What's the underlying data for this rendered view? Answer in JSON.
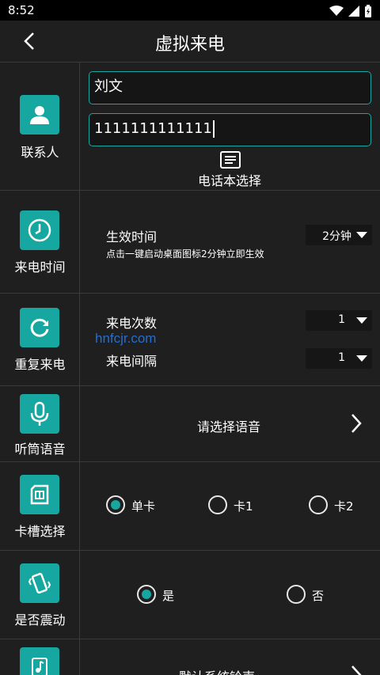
{
  "status": {
    "time": "8:52"
  },
  "title": "虚拟来电",
  "contact": {
    "label": "联系人",
    "name_value": "刘文",
    "number_value": "1111111111111",
    "phonebook_label": "电话本选择"
  },
  "call_time": {
    "label": "来电时间",
    "heading": "生效时间",
    "hint": "点击一键启动桌面图标2分钟立即生效",
    "dropdown_value": "2分钟"
  },
  "repeat": {
    "label": "重复来电",
    "count_label": "来电次数",
    "count_value": "1",
    "interval_label": "来电间隔",
    "interval_value": "1"
  },
  "watermark": "hnfcjr.com",
  "voice": {
    "label": "听筒语音",
    "prompt": "请选择语音"
  },
  "sim": {
    "label": "卡槽选择",
    "options": [
      "单卡",
      "卡1",
      "卡2"
    ],
    "selected": "单卡"
  },
  "vibrate": {
    "label": "是否震动",
    "options": [
      "是",
      "否"
    ],
    "selected": "是"
  },
  "ringtone": {
    "prompt": "默认系统铃声"
  },
  "colors": {
    "accent": "#16a7a0",
    "background": "#1f1f1f",
    "divider": "#3a3a3a",
    "watermark": "#1e6fd9"
  }
}
